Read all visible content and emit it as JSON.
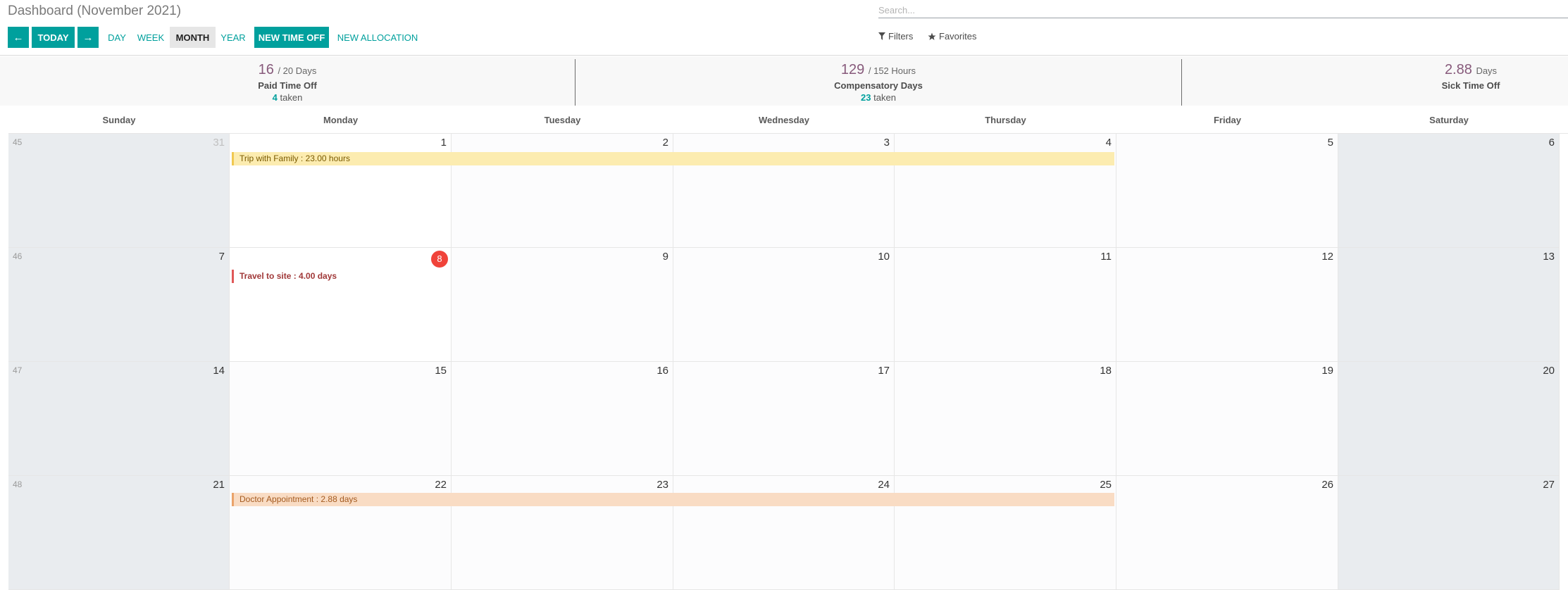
{
  "header": {
    "title": "Dashboard (November 2021)",
    "search_placeholder": "Search...",
    "buttons": {
      "today": "TODAY",
      "day": "DAY",
      "week": "WEEK",
      "month": "MONTH",
      "year": "YEAR",
      "new_time_off": "NEW TIME OFF",
      "new_allocation": "NEW ALLOCATION"
    },
    "filters_label": "Filters",
    "favorites_label": "Favorites"
  },
  "summary": [
    {
      "value": "16",
      "total": "/ 20 Days",
      "label": "Paid Time Off",
      "taken": "4",
      "taken_label": "taken"
    },
    {
      "value": "129",
      "total": "/ 152 Hours",
      "label": "Compensatory Days",
      "taken": "23",
      "taken_label": "taken"
    },
    {
      "value": "2.88",
      "total": "Days",
      "label": "Sick Time Off"
    }
  ],
  "calendar": {
    "day_names": [
      "Sunday",
      "Monday",
      "Tuesday",
      "Wednesday",
      "Thursday",
      "Friday",
      "Saturday"
    ],
    "weeks": [
      {
        "week": "45",
        "days": [
          "31",
          "1",
          "2",
          "3",
          "4",
          "5",
          "6"
        ]
      },
      {
        "week": "46",
        "days": [
          "7",
          "8",
          "9",
          "10",
          "11",
          "12",
          "13"
        ]
      },
      {
        "week": "47",
        "days": [
          "14",
          "15",
          "16",
          "17",
          "18",
          "19",
          "20"
        ]
      },
      {
        "week": "48",
        "days": [
          "21",
          "22",
          "23",
          "24",
          "25",
          "26",
          "27"
        ]
      }
    ],
    "events": [
      {
        "label": "Trip with Family : 23.00 hours",
        "bg": "#fcecb0",
        "border": "#f0c850",
        "color": "#7a5a00"
      },
      {
        "label": "Travel to site : 4.00 days",
        "bg": "#ffffff",
        "border": "#e05858",
        "color": "#a03838"
      },
      {
        "label": "Doctor Appointment : 2.88 days",
        "bg": "#f9dcc4",
        "border": "#eaa36a",
        "color": "#a45a1f"
      }
    ]
  }
}
